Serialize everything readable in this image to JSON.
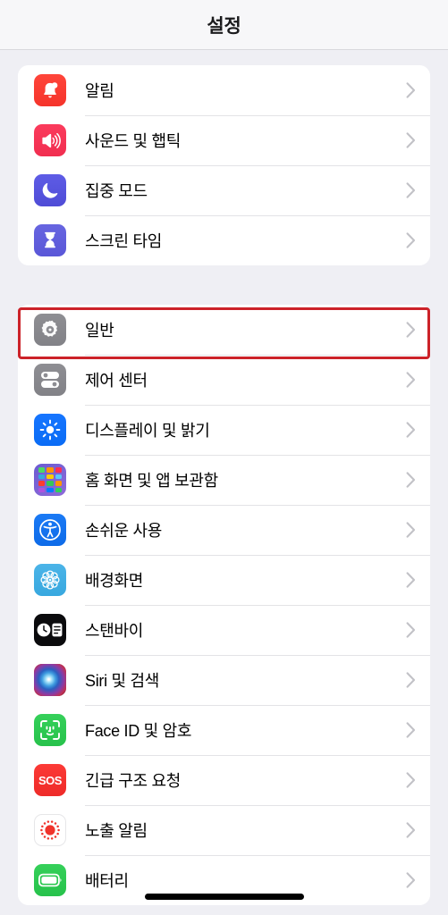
{
  "header": {
    "title": "설정"
  },
  "groups": [
    {
      "id": "group-1",
      "rows": [
        {
          "label": "알림",
          "icon": "bell-icon",
          "icon_class": "ic-notifications",
          "icon_name": "notifications-icon"
        },
        {
          "label": "사운드 및 햅틱",
          "icon": "speaker-waves-icon",
          "icon_class": "ic-sounds",
          "icon_name": "sounds-haptics-icon"
        },
        {
          "label": "집중 모드",
          "icon": "moon-icon",
          "icon_class": "ic-focus",
          "icon_name": "focus-icon"
        },
        {
          "label": "스크린 타임",
          "icon": "hourglass-icon",
          "icon_class": "ic-screentime",
          "icon_name": "screen-time-icon"
        }
      ]
    },
    {
      "id": "group-2",
      "rows": [
        {
          "label": "일반",
          "icon": "gear-icon",
          "icon_class": "ic-general",
          "icon_name": "general-icon"
        },
        {
          "label": "제어 센터",
          "icon": "sliders-icon",
          "icon_class": "ic-controlcenter",
          "icon_name": "control-center-icon"
        },
        {
          "label": "디스플레이 및 밝기",
          "icon": "sun-icon",
          "icon_class": "ic-display",
          "icon_name": "display-brightness-icon"
        },
        {
          "label": "홈 화면 및 앱 보관함",
          "icon": "app-grid-icon",
          "icon_class": "ic-homescreen",
          "icon_name": "home-screen-icon"
        },
        {
          "label": "손쉬운 사용",
          "icon": "accessibility-icon",
          "icon_class": "ic-accessibility",
          "icon_name": "accessibility-icon"
        },
        {
          "label": "배경화면",
          "icon": "flower-icon",
          "icon_class": "ic-wallpaper",
          "icon_name": "wallpaper-icon"
        },
        {
          "label": "스탠바이",
          "icon": "clock-widget-icon",
          "icon_class": "ic-standby",
          "icon_name": "standby-icon"
        },
        {
          "label": "Siri 및 검색",
          "icon": "siri-orb-icon",
          "icon_class": "ic-siri",
          "icon_name": "siri-search-icon"
        },
        {
          "label": "Face ID 및 암호",
          "icon": "face-id-icon",
          "icon_class": "ic-faceid",
          "icon_name": "face-id-passcode-icon"
        },
        {
          "label": "긴급 구조 요청",
          "icon": "sos-icon",
          "icon_class": "ic-sos",
          "icon_name": "emergency-sos-icon"
        },
        {
          "label": "노출 알림",
          "icon": "exposure-icon",
          "icon_class": "ic-exposure",
          "icon_name": "exposure-notifications-icon"
        },
        {
          "label": "배터리",
          "icon": "battery-icon",
          "icon_class": "ic-battery",
          "icon_name": "battery-icon"
        }
      ]
    }
  ],
  "highlight": {
    "target_label": "일반",
    "color": "#CC2229"
  },
  "colors": {
    "background": "#EFEFF4",
    "card": "#FFFFFF",
    "separator": "#E3E3E6",
    "chevron": "#C2C2C7",
    "label": "#000000",
    "highlight": "#CC2229"
  }
}
